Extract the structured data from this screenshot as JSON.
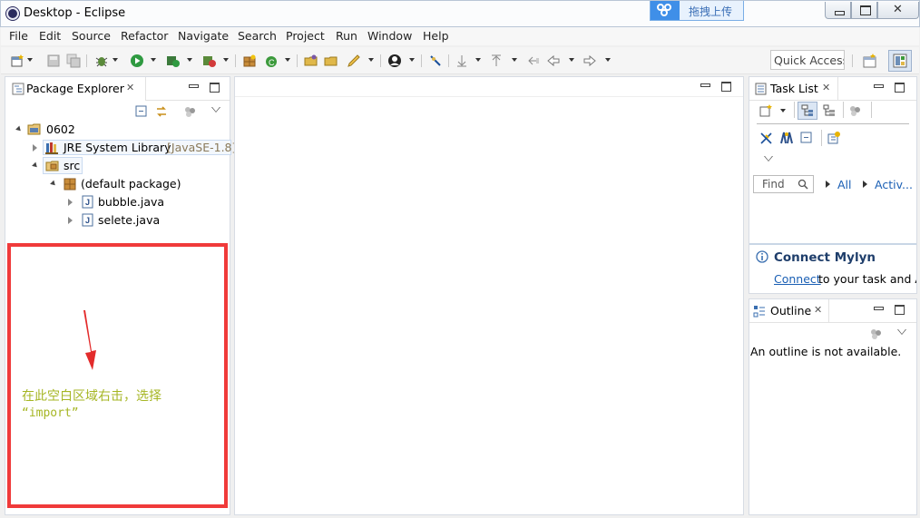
{
  "window": {
    "title": "Desktop - Eclipse"
  },
  "baidu_widget": {
    "label": "拖拽上传"
  },
  "menu": [
    "File",
    "Edit",
    "Source",
    "Refactor",
    "Navigate",
    "Search",
    "Project",
    "Run",
    "Window",
    "Help"
  ],
  "toolbar": {
    "quick_access": "Quick Access"
  },
  "package_explorer": {
    "tab_label": "Package Explorer",
    "tree": [
      {
        "label": "0602",
        "suffix": ""
      },
      {
        "label": "JRE System Library",
        "suffix": "[JavaSE-1.8]"
      },
      {
        "label": "src",
        "suffix": ""
      },
      {
        "label": "(default package)",
        "suffix": ""
      },
      {
        "label": "bubble.java",
        "suffix": ""
      },
      {
        "label": "selete.java",
        "suffix": ""
      }
    ]
  },
  "annotation": {
    "line1": "在此空白区域右击，选择",
    "line2": "“import”"
  },
  "task_list": {
    "tab_label": "Task List",
    "find_placeholder": "Find",
    "filter_all": "All",
    "filter_active": "Activ..."
  },
  "connect_mylyn": {
    "title": "Connect Mylyn",
    "link": "Connect",
    "text": " to your task and ALM tools"
  },
  "outline": {
    "tab_label": "Outline",
    "message": "An outline is not available."
  },
  "colors": {
    "annotation_box": "#f03a3a",
    "annotation_text": "#a6b624",
    "link": "#1a5fb4",
    "mylyn_title": "#1f3e6b"
  }
}
